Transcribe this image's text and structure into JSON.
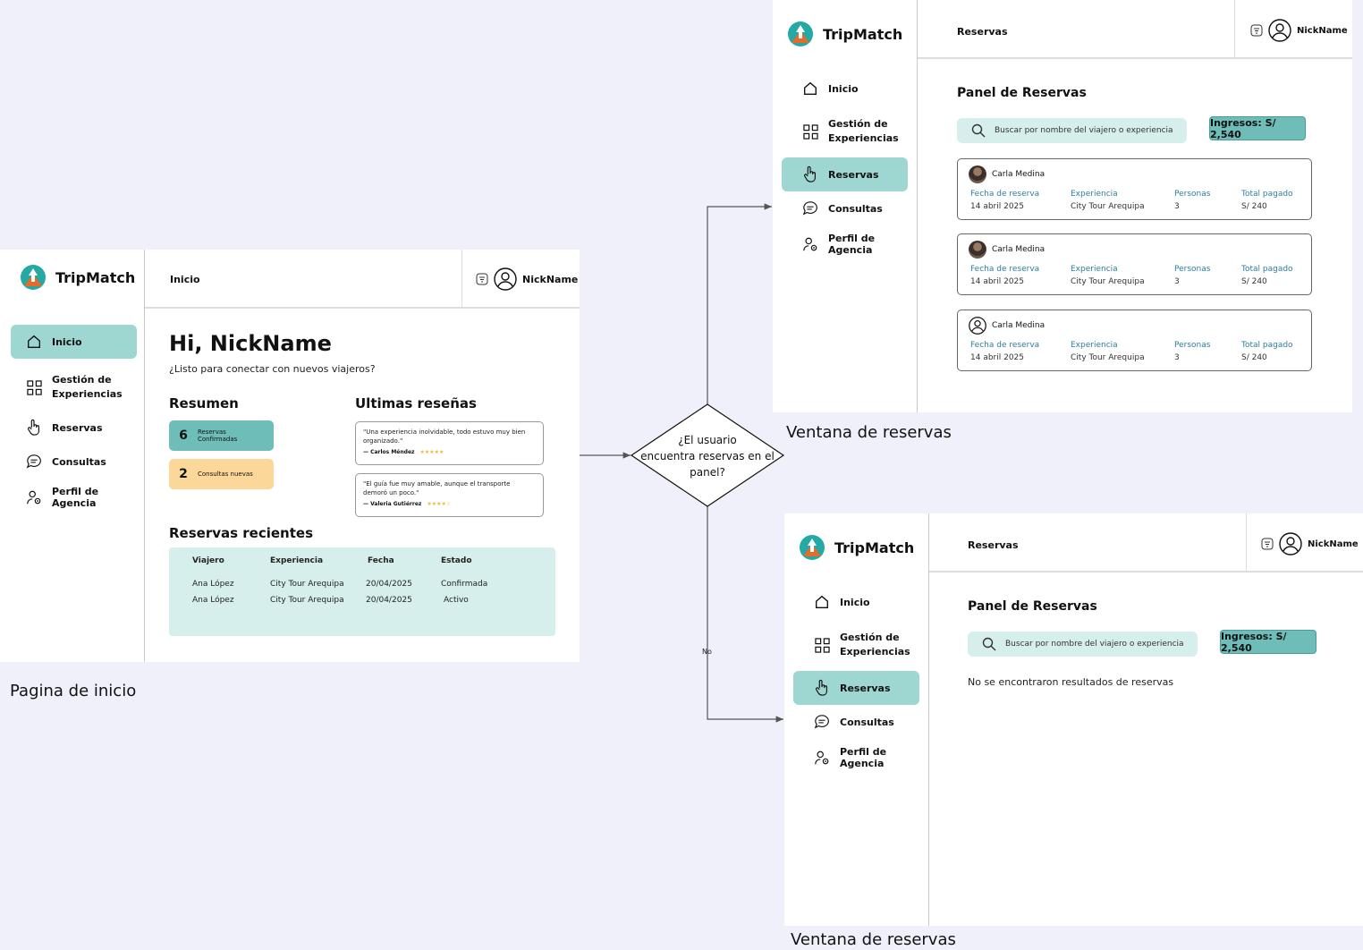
{
  "brand": {
    "name": "TripMatch"
  },
  "user": {
    "nickname": "NickName"
  },
  "nav": {
    "inicio": "Inicio",
    "gestion_line1": "Gestión de",
    "gestion_line2": "Experiencias",
    "reservas": "Reservas",
    "consultas": "Consultas",
    "perfil": "Perfil de Agencia"
  },
  "home": {
    "breadcrumb": "Inicio",
    "greeting": "Hi, NickName",
    "subtitle": "¿Listo para conectar con nuevos viajeros?",
    "resumen_title": "Resumen",
    "card_confirmed": {
      "count": "6",
      "label_line1": "Reservas",
      "label_line2": "Confirmadas"
    },
    "card_consultas": {
      "count": "2",
      "label": "Consultas nuevas"
    },
    "reviews_title": "Ultimas reseñas",
    "reviews": [
      {
        "text": "\"Una experiencia inolvidable, todo estuvo muy bien organizado.\"",
        "author": "— Carlos Méndez",
        "stars": "★★★★★"
      },
      {
        "text": "\"El guía fue muy amable, aunque el transporte demoró un poco.\"",
        "author": "— Valeria Gutiérrez",
        "stars": "★★★★☆"
      }
    ],
    "recent_title": "Reservas recientes",
    "table": {
      "headers": [
        "Viajero",
        "Experiencia",
        "Fecha",
        "Estado"
      ],
      "rows": [
        [
          "Ana López",
          "City Tour Arequipa",
          "20/04/2025",
          "Confirmada"
        ],
        [
          "Ana López",
          "City Tour Arequipa",
          "20/04/2025",
          "Activo"
        ]
      ]
    }
  },
  "reservas": {
    "breadcrumb": "Reservas",
    "panel_title": "Panel de Reservas",
    "search_placeholder": "Buscar por nombre del viajero o experiencia",
    "ingresos": "Ingresos: S/ 2,540",
    "col_labels": {
      "fecha": "Fecha de reserva",
      "experiencia": "Experiencia",
      "personas": "Personas",
      "total": "Total pagado"
    },
    "items": [
      {
        "name": "Carla Medina",
        "fecha": "14 abril 2025",
        "experiencia": "City Tour Arequipa",
        "personas": "3",
        "total": "S/ 240"
      },
      {
        "name": "Carla Medina",
        "fecha": "14 abril 2025",
        "experiencia": "City Tour Arequipa",
        "personas": "3",
        "total": "S/ 240"
      },
      {
        "name": "Carla Medina",
        "fecha": "14 abril 2025",
        "experiencia": "City Tour Arequipa",
        "personas": "3",
        "total": "S/ 240"
      }
    ],
    "empty_message": "No se encontraron resultados de reservas"
  },
  "flow": {
    "decision_line1": "¿El usuario",
    "decision_line2": "encuentra reservas en el",
    "decision_line3": "panel?",
    "no_label": "No",
    "caption_home": "Pagina de inicio",
    "caption_reservas_top": "Ventana de reservas",
    "caption_reservas_bottom": "Ventana de reservas"
  },
  "colors": {
    "accent_teal": "#9ed6d2",
    "light_teal": "#d7efec",
    "orange": "#fbd89a",
    "dark_teal": "#6fbdb9"
  }
}
